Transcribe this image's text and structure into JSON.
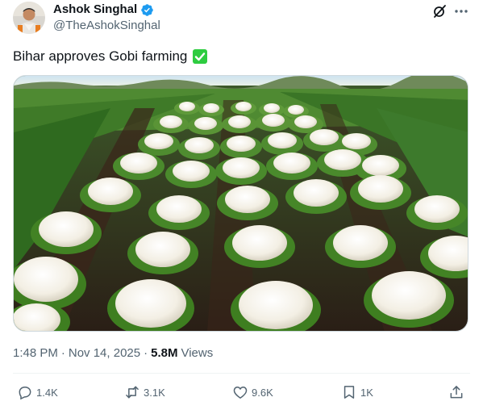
{
  "author": {
    "display_name": "Ashok Singhal",
    "handle": "@TheAshokSinghal",
    "verified": true
  },
  "post": {
    "text": "Bihar approves Gobi farming",
    "emoji": "white-heavy-check-mark"
  },
  "meta": {
    "time": "1:48 PM",
    "separator": "·",
    "date": "Nov 14, 2025",
    "separator2": "·",
    "views_count": "5.8M",
    "views_label": "Views"
  },
  "actions": {
    "reply_count": "1.4K",
    "repost_count": "3.1K",
    "like_count": "9.6K",
    "bookmark_count": "1K"
  },
  "colors": {
    "text_primary": "#0f1419",
    "text_secondary": "#536471",
    "verified_blue": "#1d9bf0",
    "check_green": "#2ecc40"
  }
}
